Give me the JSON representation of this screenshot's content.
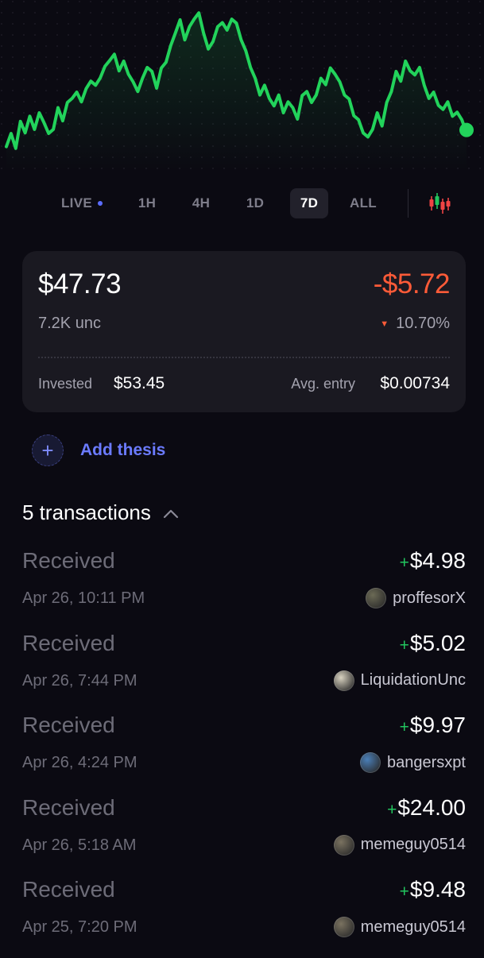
{
  "chart": {
    "line_color": "#22d35b",
    "values": [
      42,
      48,
      41,
      55,
      50,
      58,
      52,
      60,
      56,
      48,
      52,
      63,
      57,
      66,
      70,
      72,
      68,
      74,
      80,
      76,
      82,
      87,
      92,
      94,
      86,
      90,
      84,
      78,
      74,
      80,
      88,
      84,
      76,
      86,
      91,
      99,
      108,
      114,
      104,
      110,
      116,
      118,
      108,
      97,
      103,
      110,
      114,
      108,
      116,
      112,
      104,
      96,
      88,
      80,
      72,
      76,
      70,
      64,
      72,
      60,
      68,
      63,
      58,
      70,
      74,
      66,
      72,
      80,
      78,
      86,
      84,
      78,
      72,
      68,
      60,
      56,
      50,
      46,
      52,
      60,
      54,
      66,
      74,
      84,
      80,
      90,
      86,
      82,
      88,
      76,
      70,
      72,
      66,
      62,
      68,
      58,
      62,
      56,
      50
    ],
    "series_note": ""
  },
  "timeframes": {
    "live": "LIVE",
    "h1": "1H",
    "h4": "4H",
    "d1": "1D",
    "d7": "7D",
    "all": "ALL",
    "active": "7D"
  },
  "position": {
    "value": "$47.73",
    "pnl": "-$5.72",
    "quantity": "7.2K unc",
    "change_pct": "10.70%",
    "invested_label": "Invested",
    "invested_value": "$53.45",
    "avg_entry_label": "Avg. entry",
    "avg_entry_value": "$0.00734"
  },
  "thesis": {
    "label": "Add thesis"
  },
  "transactions": {
    "header": "5 transactions",
    "items": [
      {
        "type": "Received",
        "time": "Apr 26, 10:11 PM",
        "sign": "+",
        "amount": "$4.98",
        "user": "proffesorX",
        "avatar_color": "#6b6a55"
      },
      {
        "type": "Received",
        "time": "Apr 26, 7:44 PM",
        "sign": "+",
        "amount": "$5.02",
        "user": "LiquidationUnc",
        "avatar_color": "#d8d2c0"
      },
      {
        "type": "Received",
        "time": "Apr 26, 4:24 PM",
        "sign": "+",
        "amount": "$9.97",
        "user": "bangersxpt",
        "avatar_color": "#4a7fb8"
      },
      {
        "type": "Received",
        "time": "Apr 26, 5:18 AM",
        "sign": "+",
        "amount": "$24.00",
        "user": "memeguy0514",
        "avatar_color": "#7a7260"
      },
      {
        "type": "Received",
        "time": "Apr 25, 7:20 PM",
        "sign": "+",
        "amount": "$9.48",
        "user": "memeguy0514",
        "avatar_color": "#7a7260"
      }
    ]
  },
  "colors": {
    "background": "#0b0a12",
    "card": "#1a1921",
    "negative": "#ff5b38",
    "positive": "#22c55e",
    "accent": "#6b7bff"
  }
}
